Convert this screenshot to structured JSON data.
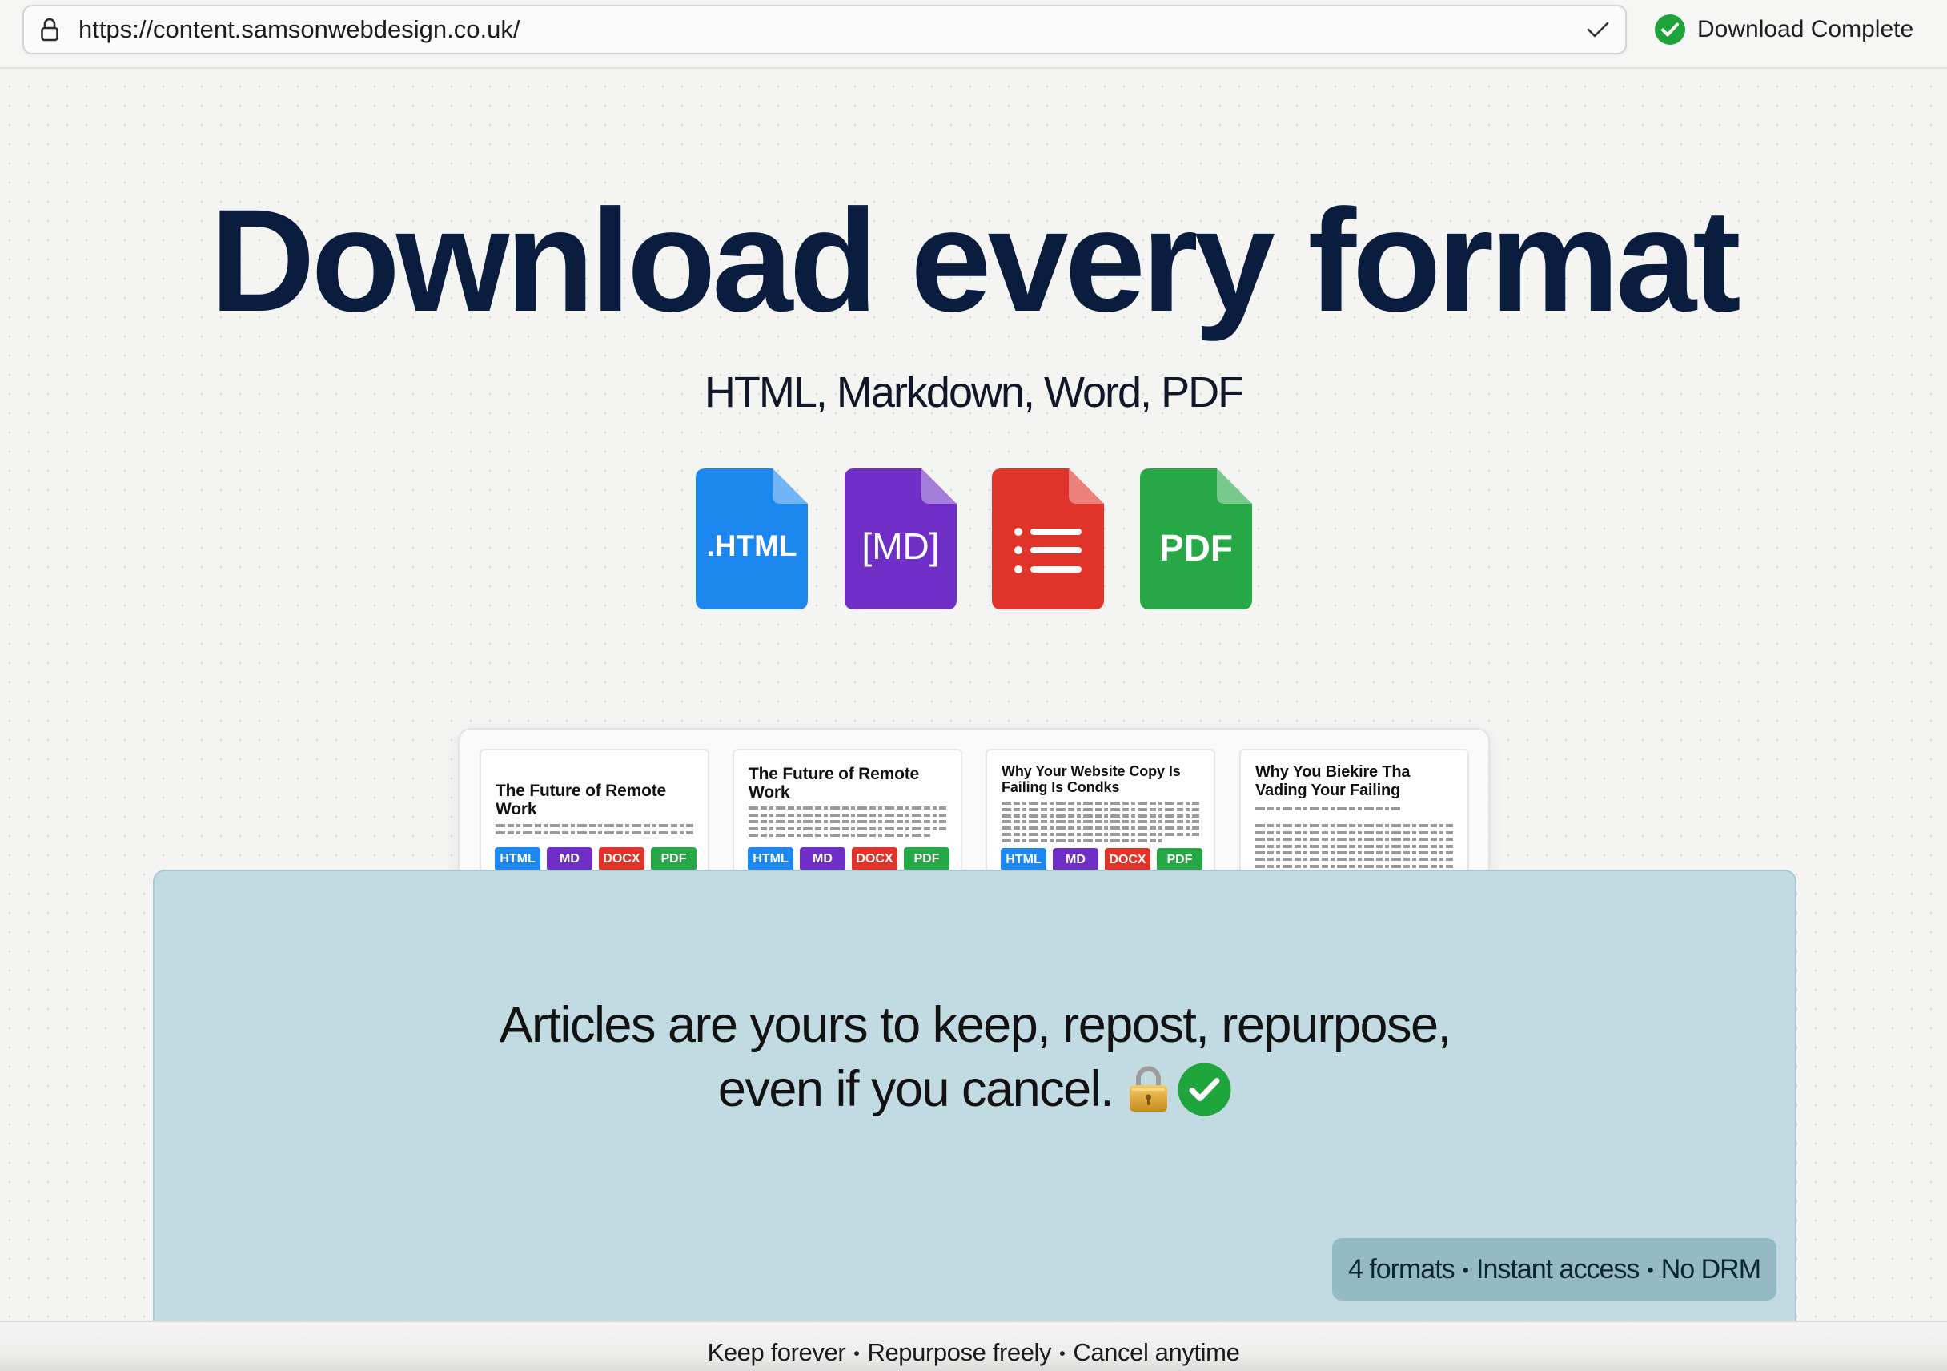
{
  "browser": {
    "url": "https://content.samsonwebdesign.co.uk/",
    "url_icon": "lock-icon",
    "url_action_icon": "check-icon",
    "status": "Download Complete",
    "status_icon": "check-circle-icon",
    "status_color": "#1fa33b"
  },
  "hero": {
    "title": "Download every format",
    "subtitle": "HTML, Markdown, Word, PDF",
    "title_color": "#0b1d3e"
  },
  "format_icons": [
    {
      "label": ".HTML",
      "icon": "html-file-icon",
      "color": "#1b87ef"
    },
    {
      "label": "[MD]",
      "icon": "markdown-file-icon",
      "color": "#6f2fc7"
    },
    {
      "icon": "word-file-icon",
      "color": "#e0342b"
    },
    {
      "label": "PDF",
      "icon": "pdf-file-icon",
      "color": "#27a846"
    }
  ],
  "preview_articles": [
    {
      "title_lines": [
        "The Future of Remote",
        "Work"
      ],
      "badges": [
        "HTML",
        "MD",
        "DOCX",
        "PDF"
      ]
    },
    {
      "title_lines": [
        "The Future of Remote",
        "Work"
      ],
      "badges": [
        "HTML",
        "MD",
        "DOCX",
        "PDF"
      ]
    },
    {
      "title_lines": [
        "Why Your Website Copy Is",
        "Failing Is Condks"
      ],
      "badges": [
        "HTML",
        "MD",
        "DOCX",
        "PDF"
      ]
    },
    {
      "title_lines": [
        "Why You Biekire Tha",
        "Vading Your Failing"
      ]
    }
  ],
  "panel": {
    "line1": "Articles are yours to keep, repost, repurpose,",
    "line2": "even if you cancel.",
    "icons": [
      "lock-icon",
      "check-circle-icon"
    ],
    "background": "#c2dbe3"
  },
  "summary_badge": {
    "items": [
      "4 formats",
      "Instant access",
      "No DRM"
    ],
    "separator": "•",
    "background": "#93bac5"
  },
  "footer": {
    "items": [
      "Keep forever",
      "Repurpose freely",
      "Cancel anytime"
    ],
    "separator": "•"
  }
}
